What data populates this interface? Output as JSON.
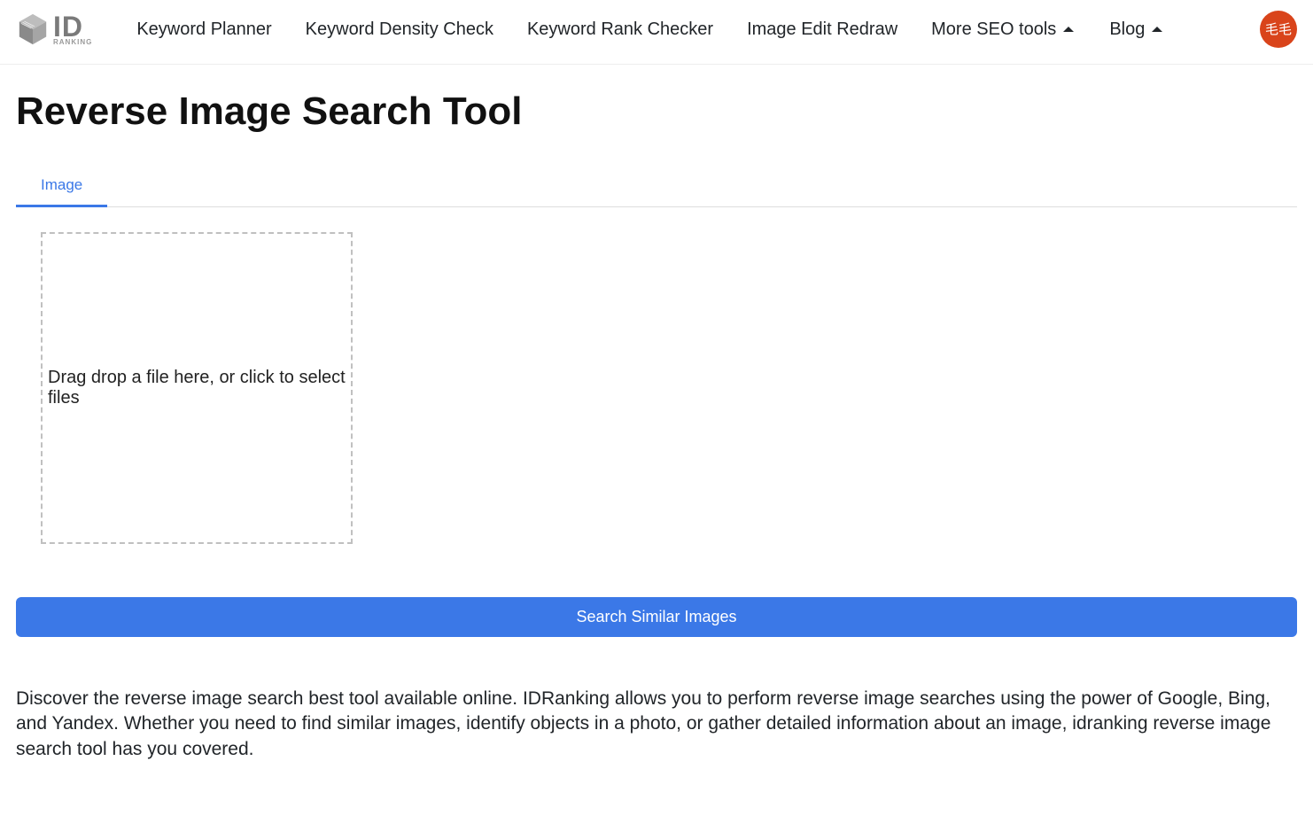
{
  "logo": {
    "id": "ID",
    "sub": "RANKING"
  },
  "nav": {
    "items": [
      {
        "label": "Keyword Planner",
        "dropdown": false
      },
      {
        "label": "Keyword Density Check",
        "dropdown": false
      },
      {
        "label": "Keyword Rank Checker",
        "dropdown": false
      },
      {
        "label": "Image Edit Redraw",
        "dropdown": false
      },
      {
        "label": "More SEO tools",
        "dropdown": true
      },
      {
        "label": "Blog",
        "dropdown": true
      }
    ]
  },
  "avatar": {
    "text": "毛毛"
  },
  "page": {
    "title": "Reverse Image Search Tool",
    "tab_image": "Image",
    "dropzone_text": "Drag drop a file here, or click to select files",
    "search_button": "Search Similar Images",
    "description": "Discover the reverse image search best tool available online. IDRanking allows you to perform reverse image searches using the power of Google, Bing, and Yandex. Whether you need to find similar images, identify objects in a photo, or gather detailed information about an image, idranking reverse image search tool has you covered."
  }
}
